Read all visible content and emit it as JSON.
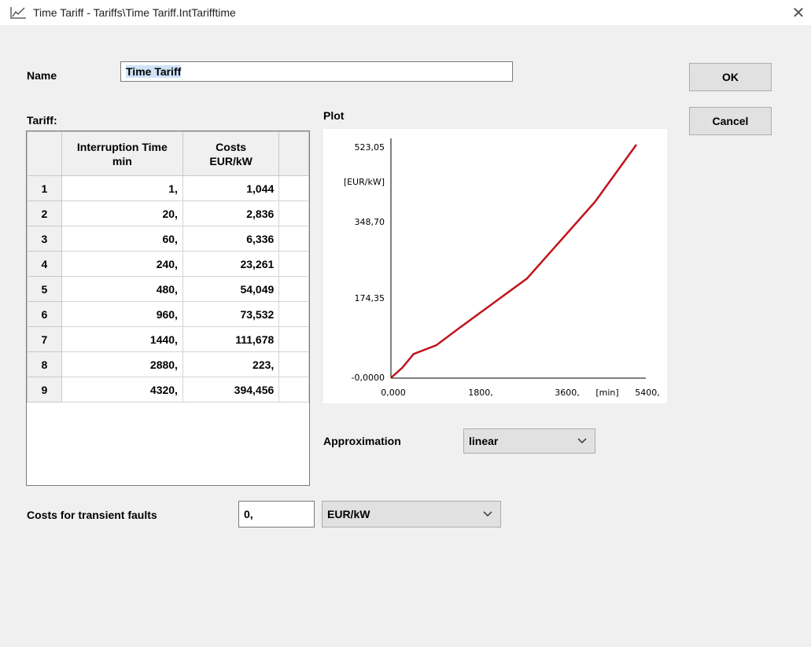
{
  "window": {
    "title": "Time Tariff - Tariffs\\Time Tariff.IntTarifftime",
    "icon": "chart-line-icon",
    "close_icon": "close-icon"
  },
  "name": {
    "label": "Name",
    "value": "Time Tariff"
  },
  "buttons": {
    "ok": "OK",
    "cancel": "Cancel"
  },
  "tariff": {
    "label": "Tariff:",
    "col1": "Interruption Time",
    "col1_unit": "min",
    "col2": "Costs",
    "col2_unit": "EUR/kW",
    "rows": [
      {
        "n": "1",
        "time": "1,",
        "cost": "1,044"
      },
      {
        "n": "2",
        "time": "20,",
        "cost": "2,836"
      },
      {
        "n": "3",
        "time": "60,",
        "cost": "6,336"
      },
      {
        "n": "4",
        "time": "240,",
        "cost": "23,261"
      },
      {
        "n": "5",
        "time": "480,",
        "cost": "54,049"
      },
      {
        "n": "6",
        "time": "960,",
        "cost": "73,532"
      },
      {
        "n": "7",
        "time": "1440,",
        "cost": "111,678"
      },
      {
        "n": "8",
        "time": "2880,",
        "cost": "223,"
      },
      {
        "n": "9",
        "time": "4320,",
        "cost": "394,456"
      }
    ]
  },
  "plot": {
    "label": "Plot"
  },
  "chart_data": {
    "type": "line",
    "x": [
      1,
      20,
      60,
      240,
      480,
      960,
      1440,
      2880,
      4320,
      5200
    ],
    "series": [
      {
        "values": [
          1.044,
          2.836,
          6.336,
          23.261,
          54.049,
          73.532,
          111.678,
          223,
          394.456,
          523.05
        ]
      }
    ],
    "ylabel": "[EUR/kW]",
    "xlabel": "[min]",
    "xlim": [
      0,
      5400
    ],
    "ylim": [
      -0.0,
      523.05
    ],
    "xticks": [
      "0,000",
      "1800,",
      "3600,",
      "5400,"
    ],
    "yticks": [
      "-0,0000",
      "174,35",
      "348,70",
      "523,05"
    ],
    "color": "#c0141c",
    "grid": false
  },
  "approximation": {
    "label": "Approximation",
    "value": "linear"
  },
  "transient": {
    "label": "Costs for transient faults",
    "value": "0,",
    "unit": "EUR/kW"
  }
}
